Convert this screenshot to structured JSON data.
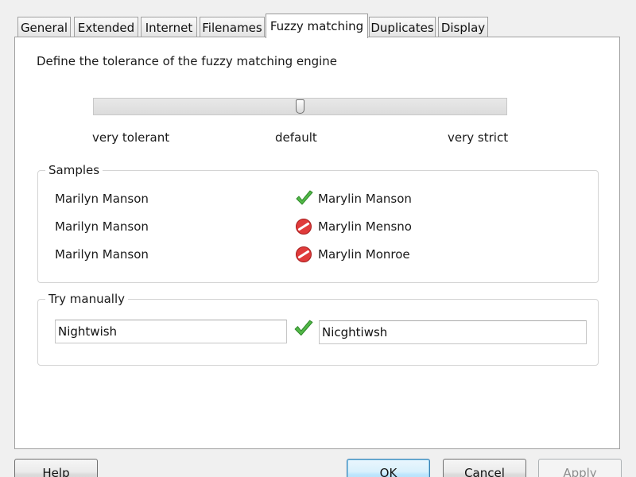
{
  "tabs": [
    {
      "label": "General",
      "active": false
    },
    {
      "label": "Extended",
      "active": false
    },
    {
      "label": "Internet",
      "active": false
    },
    {
      "label": "Filenames",
      "active": false
    },
    {
      "label": "Fuzzy matching",
      "active": true
    },
    {
      "label": "Duplicates",
      "active": false
    },
    {
      "label": "Display",
      "active": false
    }
  ],
  "fuzzy": {
    "description": "Define the tolerance of the fuzzy matching engine",
    "slider": {
      "level": 0.5,
      "labels": {
        "left": "very tolerant",
        "middle": "default",
        "right": "very strict"
      }
    }
  },
  "samples": {
    "legend": "Samples",
    "rows": [
      {
        "left": "Marilyn Manson",
        "right": "Marylin Manson",
        "match": true,
        "icon": "check-icon"
      },
      {
        "left": "Marilyn Manson",
        "right": "Marylin Mensno",
        "match": false,
        "icon": "no-match-icon"
      },
      {
        "left": "Marilyn Manson",
        "right": "Marylin Monroe",
        "match": false,
        "icon": "no-match-icon"
      }
    ]
  },
  "manual": {
    "legend": "Try manually",
    "left_value": "Nightwish",
    "right_value": "Nicghtiwsh",
    "match": true,
    "icon": "check-icon"
  },
  "buttons": {
    "help": "Help",
    "ok": "OK",
    "cancel": "Cancel",
    "apply": "Apply"
  },
  "colors": {
    "match_green": "#52b848",
    "nomatch_red": "#e03b3b",
    "dialog_background": "#f0f0f0",
    "panel_background": "#ffffff",
    "default_button_border": "#3c7fb1"
  }
}
